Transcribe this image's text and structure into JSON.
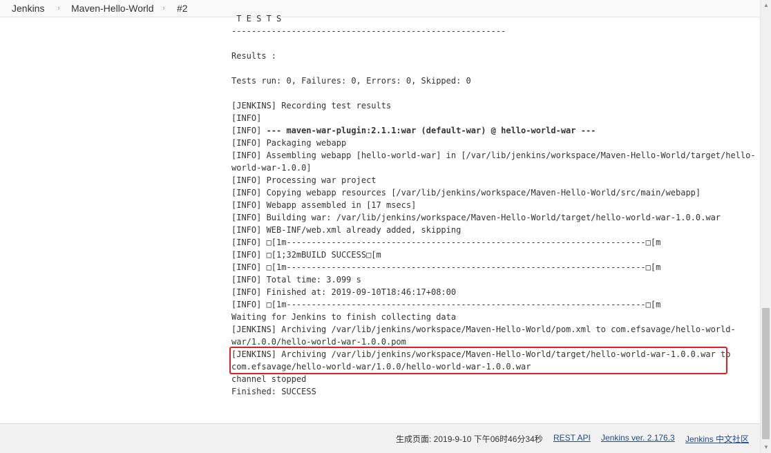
{
  "breadcrumb": {
    "items": [
      "Jenkins",
      "Maven-Hello-World",
      "#2"
    ],
    "separator": "›"
  },
  "console": {
    "lines": [
      " T E S T S",
      "-------------------------------------------------------",
      "",
      "Results :",
      "",
      "Tests run: 0, Failures: 0, Errors: 0, Skipped: 0",
      "",
      "[JENKINS] Recording test results",
      "[INFO]",
      "[INFO] --- maven-war-plugin:2.1.1:war (default-war) @ hello-world-war ---",
      "[INFO] Packaging webapp",
      "[INFO] Assembling webapp [hello-world-war] in [/var/lib/jenkins/workspace/Maven-Hello-World/target/hello-",
      "world-war-1.0.0]",
      "[INFO] Processing war project",
      "[INFO] Copying webapp resources [/var/lib/jenkins/workspace/Maven-Hello-World/src/main/webapp]",
      "[INFO] Webapp assembled in [17 msecs]",
      "[INFO] Building war: /var/lib/jenkins/workspace/Maven-Hello-World/target/hello-world-war-1.0.0.war",
      "[INFO] WEB-INF/web.xml already added, skipping",
      "[INFO] □[1m------------------------------------------------------------------------□[m",
      "[INFO] □[1;32mBUILD SUCCESS□[m",
      "[INFO] □[1m------------------------------------------------------------------------□[m",
      "[INFO] Total time: 3.099 s",
      "[INFO] Finished at: 2019-09-10T18:46:17+08:00",
      "[INFO] □[1m------------------------------------------------------------------------□[m",
      "Waiting for Jenkins to finish collecting data",
      "[JENKINS] Archiving /var/lib/jenkins/workspace/Maven-Hello-World/pom.xml to com.efsavage/hello-world-",
      "war/1.0.0/hello-world-war-1.0.0.pom",
      "[JENKINS] Archiving /var/lib/jenkins/workspace/Maven-Hello-World/target/hello-world-war-1.0.0.war to",
      "com.efsavage/hello-world-war/1.0.0/hello-world-war-1.0.0.war",
      "channel stopped",
      "Finished: SUCCESS"
    ],
    "bold_line_prefix": "[INFO] ",
    "bold_line_body": "--- maven-war-plugin:2.1.1:war (default-war) @ hello-world-war ---"
  },
  "footer": {
    "generated": "生成页面: 2019-9-10 下午06时46分34秒",
    "rest_api": "REST API",
    "version": "Jenkins ver. 2.176.3",
    "community": "Jenkins 中文社区"
  },
  "colors": {
    "highlight": "#e02020",
    "link": "#204a87"
  }
}
